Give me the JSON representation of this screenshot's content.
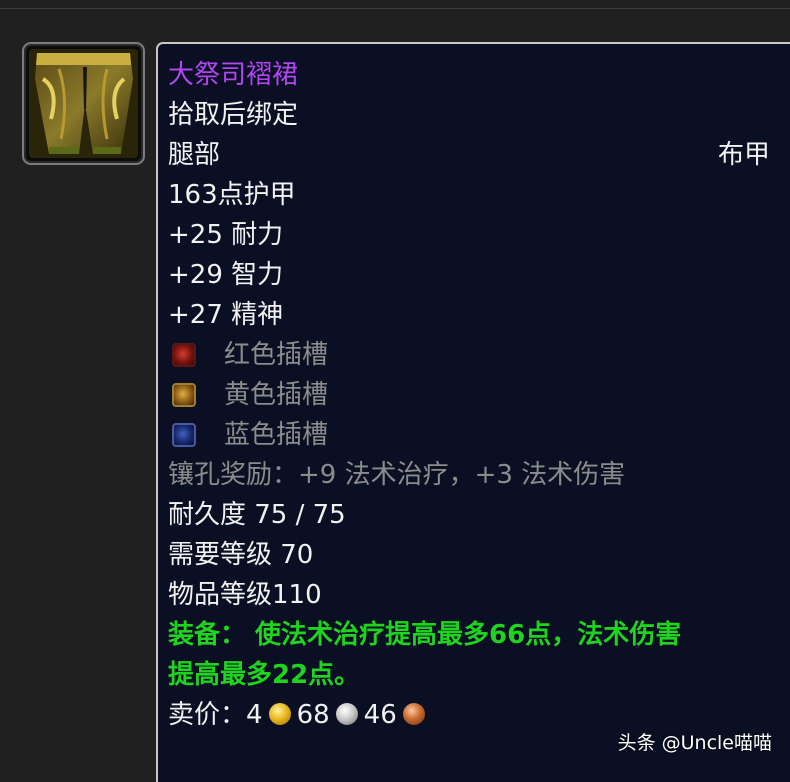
{
  "item": {
    "name": "大祭司褶裙",
    "name_color": "#b046f0",
    "binding": "拾取后绑定",
    "slot": "腿部",
    "armor_type": "布甲",
    "armor": "163点护甲",
    "stats": [
      "+25 耐力",
      "+29 智力",
      "+27 精神"
    ],
    "sockets": [
      {
        "label": "红色插槽",
        "color": "red",
        "icon": "red-socket-icon"
      },
      {
        "label": "黄色插槽",
        "color": "yellow",
        "icon": "yellow-socket-icon"
      },
      {
        "label": "蓝色插槽",
        "color": "blue",
        "icon": "blue-socket-icon"
      }
    ],
    "socket_bonus": "镶孔奖励：+9 法术治疗，+3 法术伤害",
    "durability": "耐久度 75 / 75",
    "required_level": "需要等级 70",
    "item_level": "物品等级110",
    "equip_line1": "装备：  使法术治疗提高最多66点，法术伤害",
    "equip_line2": "提高最多22点。",
    "equip_color": "#1fd31f",
    "sell_label": "卖价：",
    "sell_gold": "4",
    "sell_silver": "68",
    "sell_copper": "46",
    "icon": "cloth-legs-icon"
  },
  "watermark": "头条 @Uncle喵喵"
}
